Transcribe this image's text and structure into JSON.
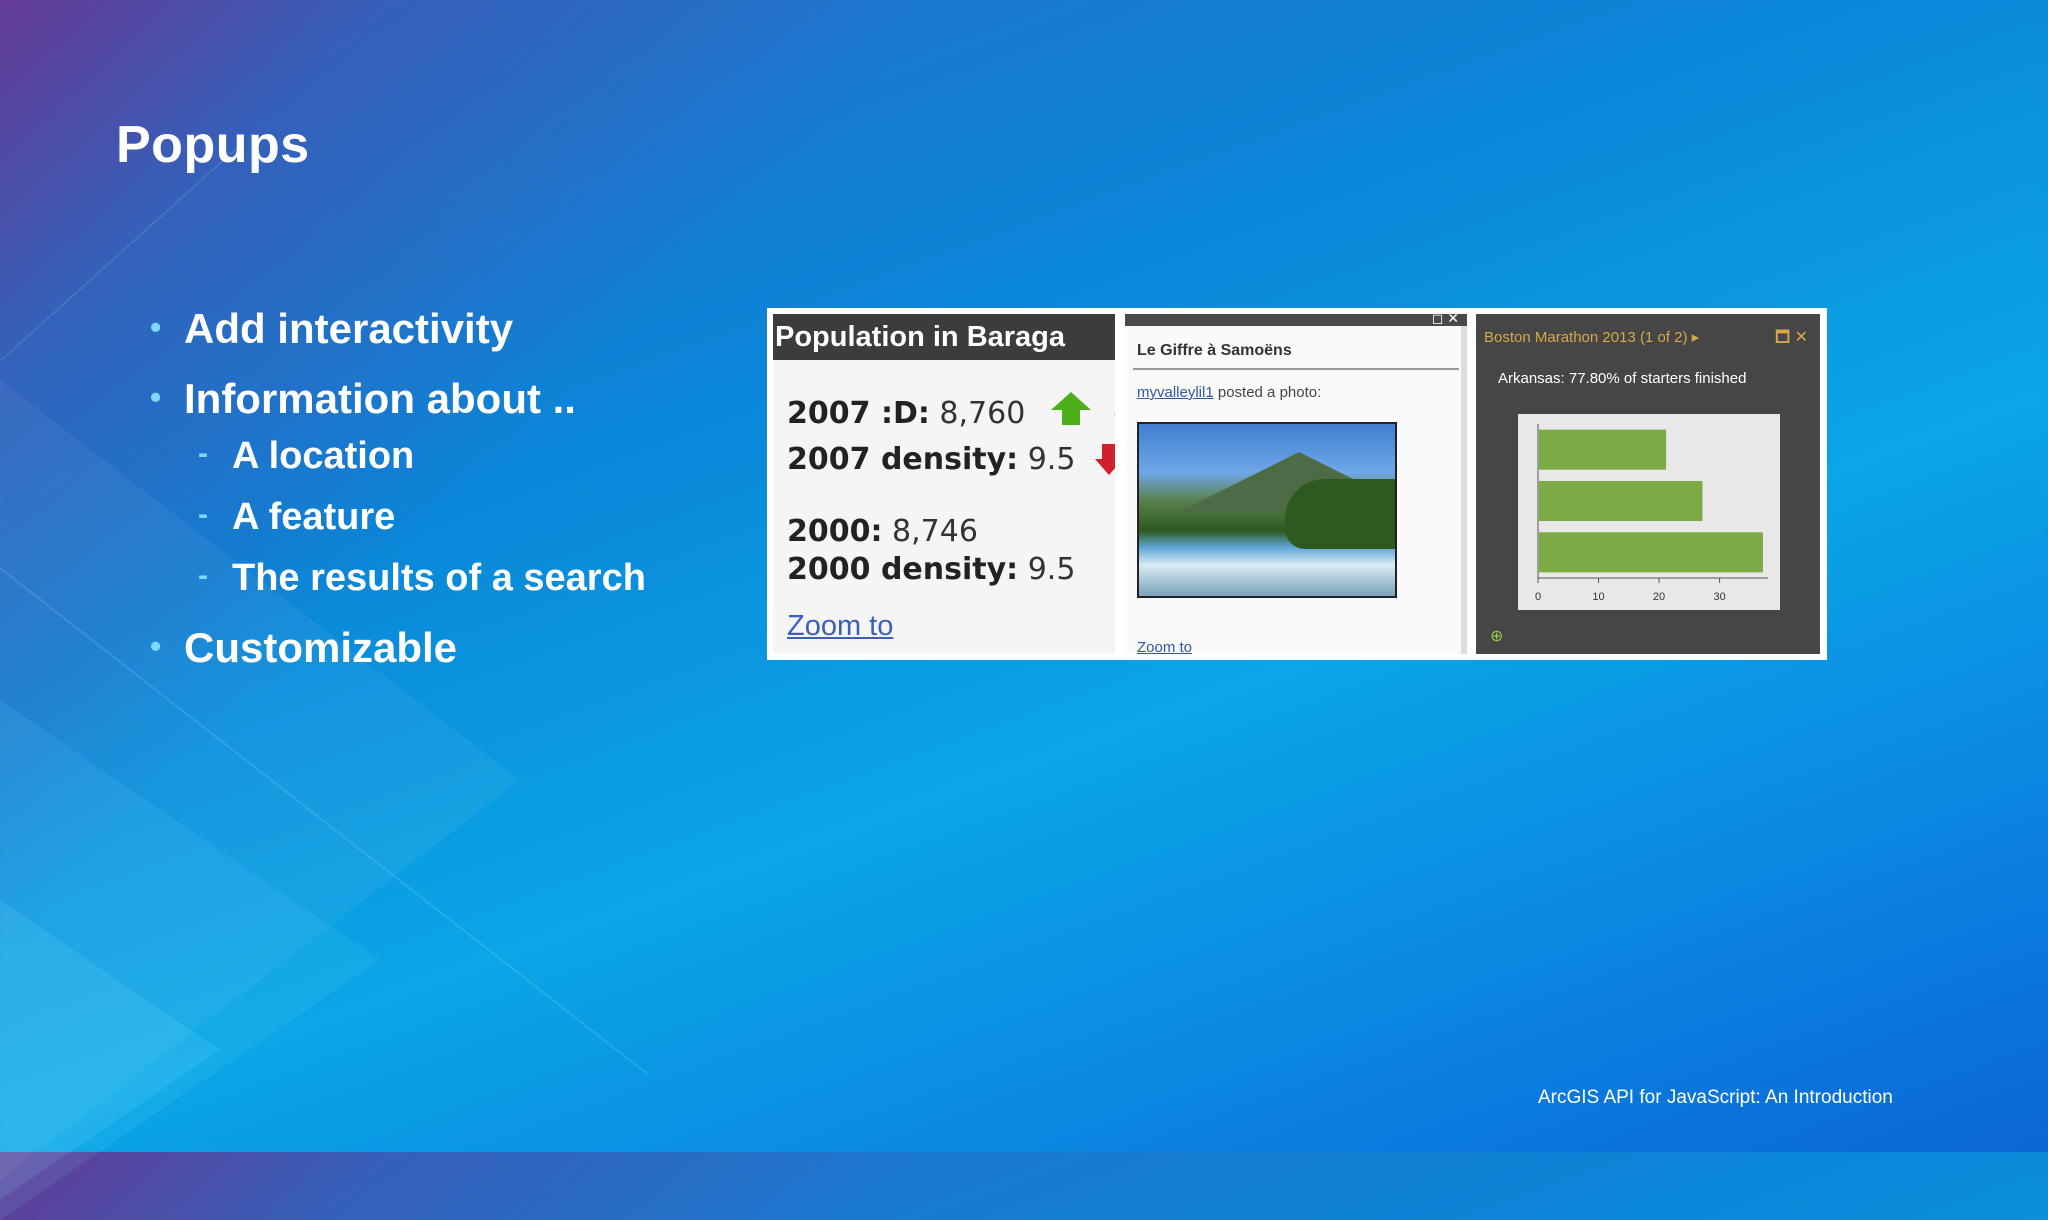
{
  "slide": {
    "title": "Popups",
    "bullets": [
      {
        "label": "Add interactivity"
      },
      {
        "label": "Information about .."
      },
      {
        "label": "Customizable"
      }
    ],
    "sub_bullets": [
      {
        "label": "A location"
      },
      {
        "label": "A feature"
      },
      {
        "label": "The results of a search"
      }
    ],
    "footer": "ArcGIS API for JavaScript: An Introduction"
  },
  "popup1": {
    "title": "Population in Baraga",
    "rows": [
      {
        "label": "2007 :D:",
        "value": "8,760"
      },
      {
        "label": "2007 density:",
        "value": "9.5"
      },
      {
        "label": "2000:",
        "value": "8,746"
      },
      {
        "label": "2000 density:",
        "value": "9.5"
      }
    ],
    "zoom_label": "Zoom to",
    "paren": "(",
    "up_color": "#4caf1a",
    "down_color": "#d0202a"
  },
  "popup2": {
    "title": "Le Giffre à Samoëns",
    "user": "myvalleylil1",
    "posted_text": " posted a photo:",
    "zoom_label": "Zoom to",
    "window_icons": "◻ ✕"
  },
  "popup3": {
    "title": "Boston Marathon 2013 (1 of 2) ▸",
    "window_icons": "🗖 ✕",
    "subtitle": "Arkansas: 77.80% of starters finished",
    "zoom_icon": "⊕"
  },
  "chart_data": {
    "type": "bar",
    "orientation": "horizontal",
    "values": [
      21,
      27,
      37
    ],
    "xlim": [
      0,
      38
    ],
    "x_ticks": [
      "0",
      "10",
      "20",
      "30"
    ],
    "bar_color": "#7cab45"
  }
}
